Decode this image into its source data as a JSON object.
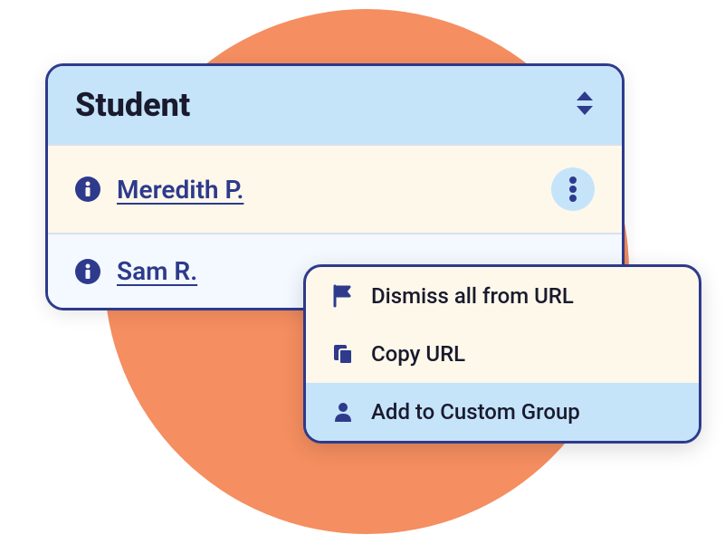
{
  "panel": {
    "header": "Student"
  },
  "students": [
    {
      "name": "Meredith P."
    },
    {
      "name": "Sam R."
    }
  ],
  "menu": {
    "items": [
      {
        "label": "Dismiss all from URL"
      },
      {
        "label": "Copy URL"
      },
      {
        "label": "Add to Custom Group"
      }
    ]
  }
}
